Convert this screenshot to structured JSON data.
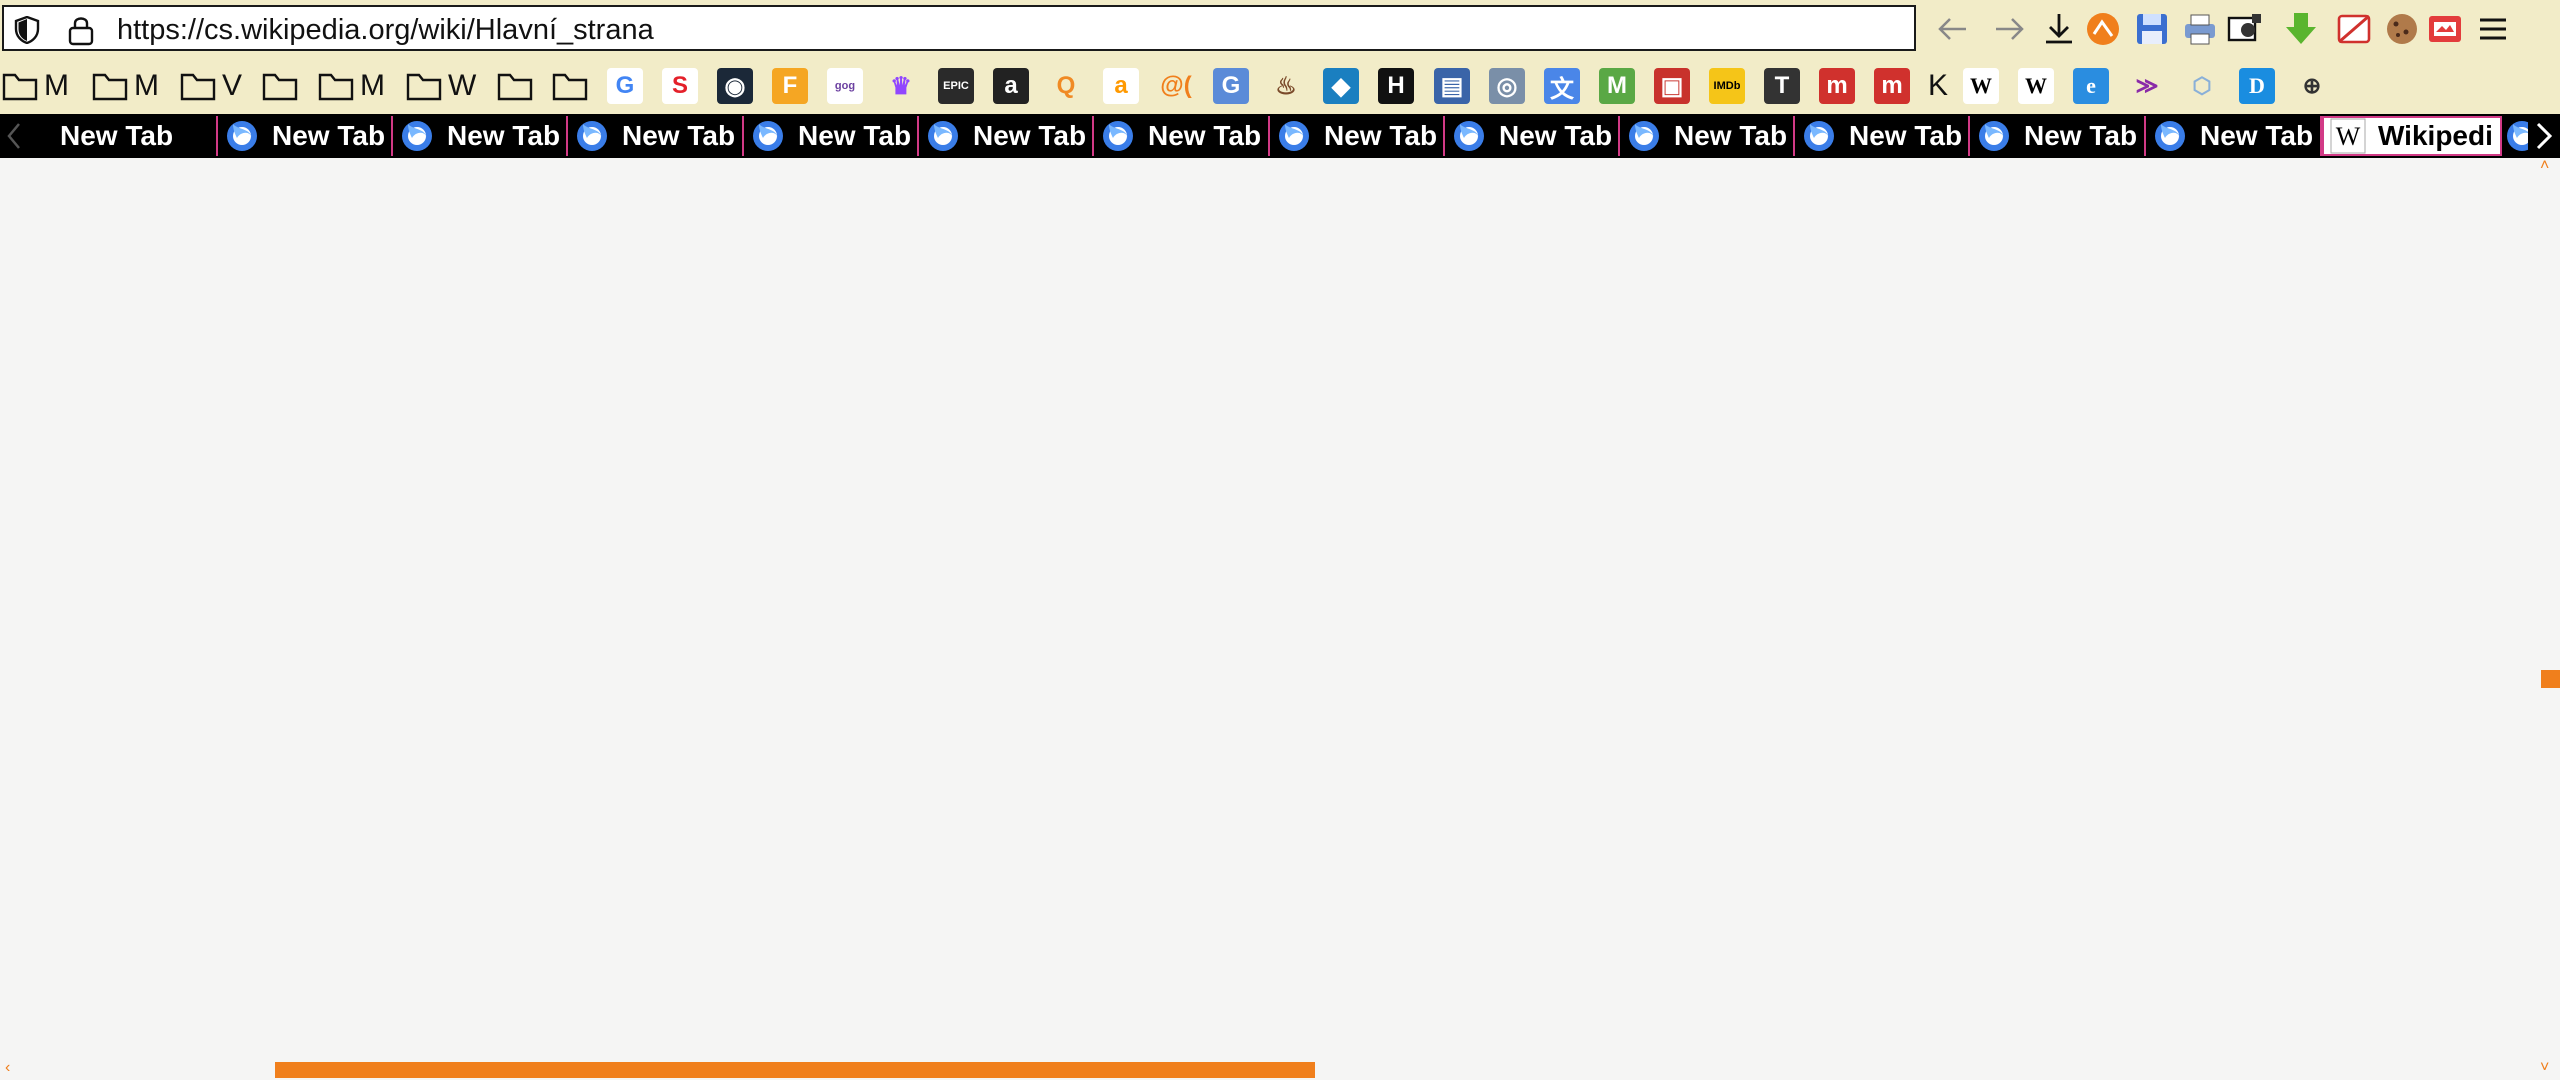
{
  "browser": {
    "url": "https://cs.wikipedia.org/wiki/Hlavní_strana",
    "toolbar_icons": [
      "back-icon",
      "forward-icon",
      "download-icon",
      "extension-orange-icon",
      "save-icon",
      "print-icon",
      "screenshot-icon",
      "download-green-icon",
      "media-blocked-icon",
      "cookie-icon",
      "reader-icon",
      "menu-icon"
    ]
  },
  "bookmarks": {
    "folders": [
      {
        "label": "M"
      },
      {
        "label": "M"
      },
      {
        "label": "V"
      },
      {
        "label": ""
      },
      {
        "label": "M"
      },
      {
        "label": "W"
      },
      {
        "label": ""
      },
      {
        "label": ""
      }
    ],
    "favicons": [
      {
        "name": "google-icon",
        "glyph": "G",
        "color": "#ffffff",
        "fg": "#4285f4"
      },
      {
        "name": "s-icon",
        "glyph": "S",
        "color": "#ffffff",
        "fg": "#e4202a"
      },
      {
        "name": "steam-icon",
        "glyph": "◉",
        "color": "#1b2838",
        "fg": "#ffffff"
      },
      {
        "name": "orange-circle-icon",
        "glyph": "F",
        "color": "#f5a623",
        "fg": "#ffffff"
      },
      {
        "name": "gog-icon",
        "glyph": "gog",
        "color": "#ffffff",
        "fg": "#6b3fa0"
      },
      {
        "name": "crown-icon",
        "glyph": "♛",
        "color": "#f2ecc8",
        "fg": "#9146ff"
      },
      {
        "name": "epic-games-icon",
        "glyph": "EPIC",
        "color": "#2a2a2a",
        "fg": "#ffffff"
      },
      {
        "name": "a-icon",
        "glyph": "a",
        "color": "#222222",
        "fg": "#ffffff"
      },
      {
        "name": "check-magnifier-icon",
        "glyph": "Q",
        "color": "#f2ecc8",
        "fg": "#f08a24"
      },
      {
        "name": "amazon-icon",
        "glyph": "a",
        "color": "#ffffff",
        "fg": "#ff9900"
      },
      {
        "name": "at-icon",
        "glyph": "@(",
        "color": "#f2ecc8",
        "fg": "#f07f1c"
      },
      {
        "name": "g-box-icon",
        "glyph": "G",
        "color": "#5b8bd8",
        "fg": "#ffffff"
      },
      {
        "name": "fire-icon",
        "glyph": "♨",
        "color": "#f2ecc8",
        "fg": "#7a4a2a"
      },
      {
        "name": "blue-bird-icon",
        "glyph": "◆",
        "color": "#1a7fc0",
        "fg": "#ffffff"
      },
      {
        "name": "h-icon",
        "glyph": "H",
        "color": "#111111",
        "fg": "#ffffff"
      },
      {
        "name": "book-icon",
        "glyph": "▤",
        "color": "#3a64a8",
        "fg": "#ffffff"
      },
      {
        "name": "globe-disc-icon",
        "glyph": "◎",
        "color": "#7a8fa8",
        "fg": "#ffffff"
      },
      {
        "name": "translate-icon",
        "glyph": "文",
        "color": "#4a86e8",
        "fg": "#ffffff"
      },
      {
        "name": "m-circle-icon",
        "glyph": "M",
        "color": "#5aa845",
        "fg": "#ffffff"
      },
      {
        "name": "picture-red-icon",
        "glyph": "▣",
        "color": "#c8322c",
        "fg": "#ffffff"
      },
      {
        "name": "imdb-icon",
        "glyph": "IMDb",
        "color": "#f5c518",
        "fg": "#000000"
      },
      {
        "name": "t-icon",
        "glyph": "T",
        "color": "#333333",
        "fg": "#ffffff"
      },
      {
        "name": "m-red-icon",
        "glyph": "m",
        "color": "#d0312d",
        "fg": "#ffffff"
      },
      {
        "name": "m-red2-icon",
        "glyph": "m",
        "color": "#d0312d",
        "fg": "#ffffff"
      }
    ],
    "text_k": "K",
    "favicons_b": [
      {
        "name": "wikipedia-icon",
        "glyph": "W",
        "color": "#ffffff",
        "fg": "#000000"
      },
      {
        "name": "wikipedia2-icon",
        "glyph": "W",
        "color": "#ffffff",
        "fg": "#000000"
      },
      {
        "name": "e-icon",
        "glyph": "e",
        "color": "#2a8de0",
        "fg": "#ffffff"
      },
      {
        "name": "chevrons-icon",
        "glyph": "≫",
        "color": "#f2ecc8",
        "fg": "#8a2aa8"
      },
      {
        "name": "hex-icon",
        "glyph": "⬡",
        "color": "#f2ecc8",
        "fg": "#8ab0d8"
      },
      {
        "name": "d-icon",
        "glyph": "D",
        "color": "#1a8de0",
        "fg": "#ffffff"
      },
      {
        "name": "globe-icon",
        "glyph": "⊕",
        "color": "#f2ecc8",
        "fg": "#333333"
      }
    ]
  },
  "tabs": [
    {
      "label": "New Tab",
      "icon": "none"
    },
    {
      "label": "New Tab",
      "icon": "firefox"
    },
    {
      "label": "New Tab",
      "icon": "firefox"
    },
    {
      "label": "New Tab",
      "icon": "firefox"
    },
    {
      "label": "New Tab",
      "icon": "firefox"
    },
    {
      "label": "New Tab",
      "icon": "firefox"
    },
    {
      "label": "New Tab",
      "icon": "firefox"
    },
    {
      "label": "New Tab",
      "icon": "firefox"
    },
    {
      "label": "New Tab",
      "icon": "firefox"
    },
    {
      "label": "New Tab",
      "icon": "firefox"
    },
    {
      "label": "New Tab",
      "icon": "firefox"
    },
    {
      "label": "New Tab",
      "icon": "firefox"
    },
    {
      "label": "New Tab",
      "icon": "firefox"
    },
    {
      "label": "Wikipedi",
      "icon": "wikipedia",
      "active": true
    }
  ],
  "colors": {
    "toolbar_bg": "#f2ecc8",
    "tab_separator": "#d23a86",
    "accent": "#f07f1c",
    "content_bg": "#f5f5f4"
  }
}
